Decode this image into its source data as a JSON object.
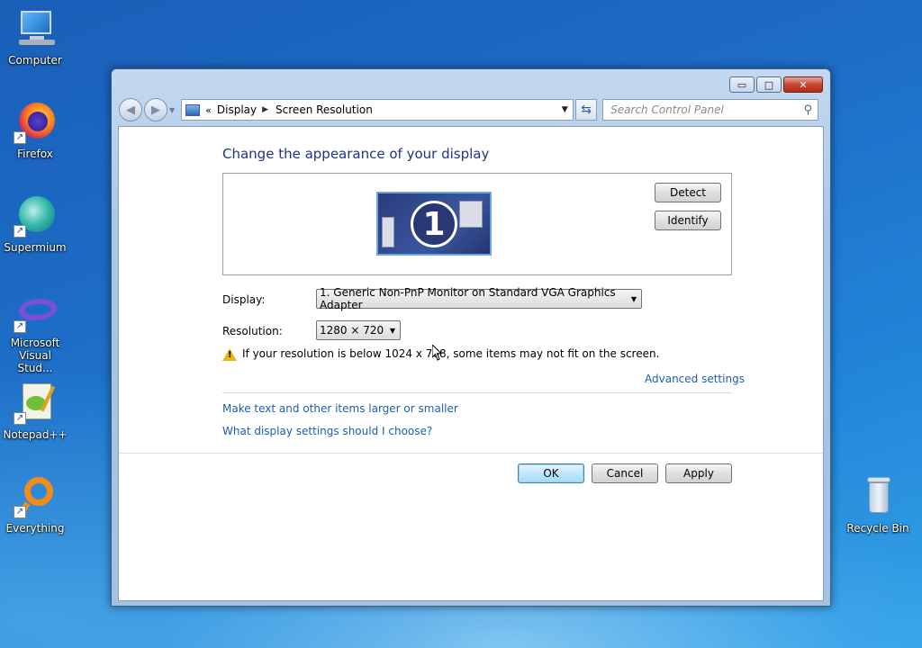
{
  "desktop": {
    "icons": [
      {
        "label": "Computer"
      },
      {
        "label": "Firefox"
      },
      {
        "label": "Supermium"
      },
      {
        "label": "Microsoft Visual Stud..."
      },
      {
        "label": "Notepad++"
      },
      {
        "label": "Everything"
      },
      {
        "label": "Recycle Bin"
      }
    ]
  },
  "window": {
    "caption_buttons": {
      "minimize": "▭",
      "maximize": "□",
      "close": "✕"
    },
    "address": {
      "overflow": "«",
      "crumbs": [
        "Display",
        "Screen Resolution"
      ]
    },
    "search": {
      "placeholder": "Search Control Panel"
    },
    "title": "Change the appearance of your display",
    "monitor_number": "1",
    "detect_label": "Detect",
    "identify_label": "Identify",
    "display": {
      "label": "Display:",
      "value": "1. Generic Non-PnP Monitor on Standard VGA Graphics Adapter"
    },
    "resolution": {
      "label": "Resolution:",
      "value": "1280 × 720"
    },
    "warning": "If your resolution is below 1024 x 768, some items may not fit on the screen.",
    "advanced_link": "Advanced settings",
    "links": [
      "Make text and other items larger or smaller",
      "What display settings should I choose?"
    ],
    "buttons": {
      "ok": "OK",
      "cancel": "Cancel",
      "apply": "Apply"
    }
  },
  "colors": {
    "title": "#1e3287",
    "link": "#1a5fb0",
    "warning": "#e8b812"
  }
}
